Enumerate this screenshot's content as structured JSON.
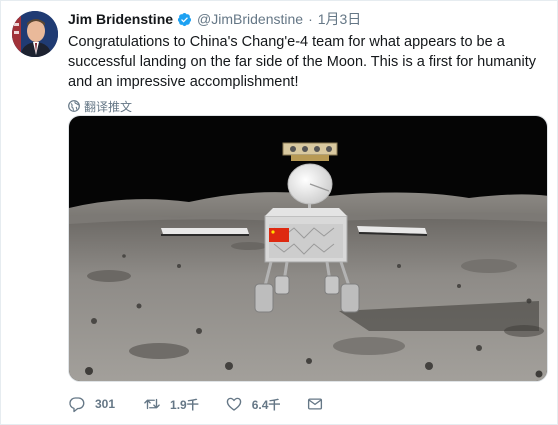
{
  "author": {
    "name": "Jim Bridenstine",
    "handle": "@JimBridenstine",
    "separator": "·",
    "timestamp": "1月3日"
  },
  "tweet": {
    "text": "Congratulations to China's Chang'e-4 team for what appears to be a successful landing on the far side of the Moon. This is a first for humanity and an impressive accomplishment!",
    "translate_label": "翻译推文"
  },
  "actions": {
    "replies": "301",
    "retweets": "1.9千",
    "likes": "6.4千"
  },
  "icons": {
    "verified": "verified-badge-icon",
    "translate": "globe-icon",
    "reply": "reply-icon",
    "retweet": "retweet-icon",
    "like": "heart-icon",
    "message": "envelope-icon"
  },
  "colors": {
    "verified_blue": "#1da1f2",
    "muted": "#657786",
    "text": "#14171a"
  }
}
